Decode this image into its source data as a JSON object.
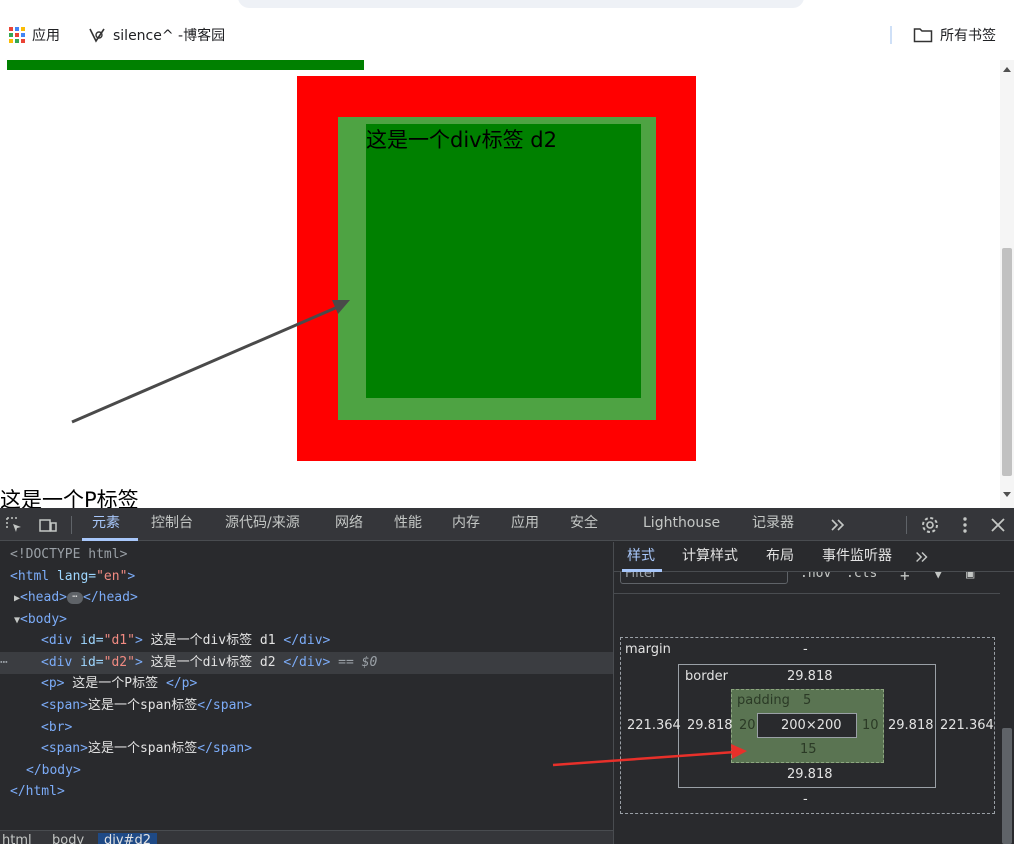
{
  "bookmarks": {
    "apps_label": "应用",
    "cnblogs_label": "silence^ -博客园",
    "all_bookmarks_label": "所有书签"
  },
  "page": {
    "d2_text": "这是一个div标签 d2",
    "p_text": "这是一个P标签"
  },
  "devtools": {
    "tabs": [
      "元素",
      "控制台",
      "源代码/来源",
      "网络",
      "性能",
      "内存",
      "应用",
      "安全",
      "Lighthouse",
      "记录器"
    ],
    "active_tab": "元素",
    "elements": {
      "doctype": "<!DOCTYPE html>",
      "html_open_tag": "<html",
      "html_lang_attr": " lang=",
      "html_lang_val": "\"en\"",
      "html_open_close": ">",
      "head_open": "<head>",
      "head_close": "</head>",
      "head_ellipsis": "⋯",
      "body_open": "<body>",
      "d1_open": "<div",
      "d1_attr": " id=",
      "d1_val": "\"d1\"",
      "d1_gt": ">",
      "d1_text": " 这是一个div标签 d1 ",
      "d1_close": "</div>",
      "d2_open": "<div",
      "d2_attr": " id=",
      "d2_val": "\"d2\"",
      "d2_gt": ">",
      "d2_text": " 这是一个div标签 d2 ",
      "d2_close": "</div>",
      "d2_marker": " == $0",
      "p_open": "<p>",
      "p_text": " 这是一个P标签 ",
      "p_close": "</p>",
      "span1_open": "<span>",
      "span1_text": "这是一个span标签",
      "span1_close": "</span>",
      "br": "<br>",
      "span2_open": "<span>",
      "span2_text": "这是一个span标签",
      "span2_close": "</span>",
      "body_close": "</body>",
      "html_close": "</html>",
      "row_dots": "⋯"
    },
    "breadcrumb": [
      "html",
      "body",
      "div#d2"
    ],
    "styles_tabs": [
      "样式",
      "计算样式",
      "布局",
      "事件监听器"
    ],
    "styles_active_tab": "样式",
    "filter_placeholder": "Filter",
    "filter_hov": ":hov",
    "filter_cls": ".cls",
    "box_model": {
      "margin_label": "margin",
      "margin_top": "-",
      "margin_bottom": "-",
      "margin_left": "221.364",
      "margin_right": "221.364",
      "border_label": "border",
      "border_top": "29.818",
      "border_bottom": "29.818",
      "border_left": "29.818",
      "border_right": "29.818",
      "padding_label": "padding",
      "padding_top": "5",
      "padding_bottom": "15",
      "padding_left": "20",
      "padding_right": "10",
      "content_size": "200×200"
    }
  },
  "colors": {
    "d1_background": "#ff0000",
    "d2_border": "#4ea343",
    "d2_background": "#008000",
    "annotation_arrow_red": "#e8302a",
    "annotation_arrow_dark": "#4a4a4a"
  }
}
